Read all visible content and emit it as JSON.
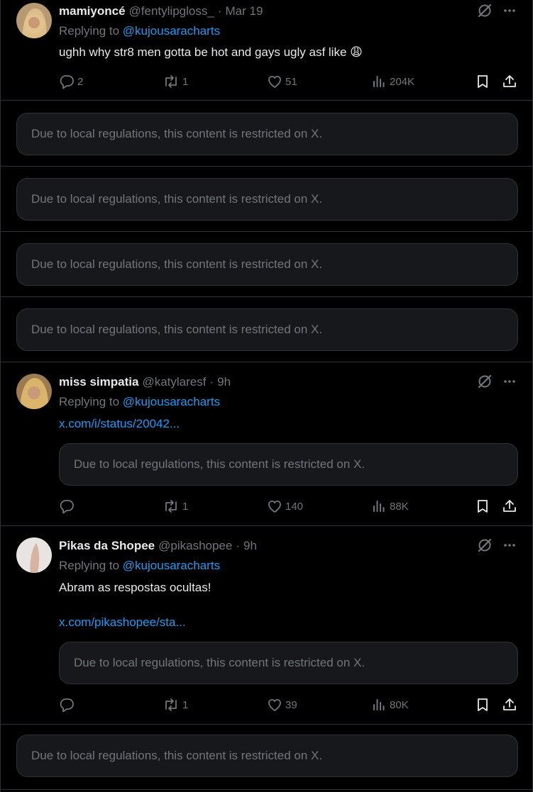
{
  "colors": {
    "background": "#000000",
    "text": "#e7e9ea",
    "muted": "#71767b",
    "link": "#1d9bf0",
    "card": "#16181c",
    "border": "#2f3336"
  },
  "restricted_notice": "Due to local regulations, this content is restricted on X.",
  "tweet1": {
    "name": "mamiyoncé",
    "handle": "@fentylipgloss_",
    "separator": "·",
    "time": "Mar 19",
    "replying_label": "Replying to",
    "replying_to": "@kujousaracharts",
    "text": "ughh why str8 men gotta be hot and gays ugly asf like 😩",
    "replies": "2",
    "reposts": "1",
    "likes": "51",
    "views": "204K"
  },
  "tweet2": {
    "name": "miss simpatia",
    "handle": "@katylaresf",
    "separator": "·",
    "time": "9h",
    "replying_label": "Replying to",
    "replying_to": "@kujousaracharts",
    "link": "x.com/i/status/20042...",
    "replies": "",
    "reposts": "1",
    "likes": "140",
    "views": "88K"
  },
  "tweet3": {
    "name": "Pikas da Shopee",
    "handle": "@pikashopee",
    "separator": "·",
    "time": "9h",
    "replying_label": "Replying to",
    "replying_to": "@kujousaracharts",
    "text": "Abram as respostas ocultas!",
    "link": "x.com/pikashopee/sta...",
    "replies": "",
    "reposts": "1",
    "likes": "39",
    "views": "80K"
  },
  "icons": [
    "grok-icon",
    "more-icon",
    "reply-icon",
    "repost-icon",
    "like-icon",
    "views-icon",
    "bookmark-icon",
    "share-icon"
  ]
}
